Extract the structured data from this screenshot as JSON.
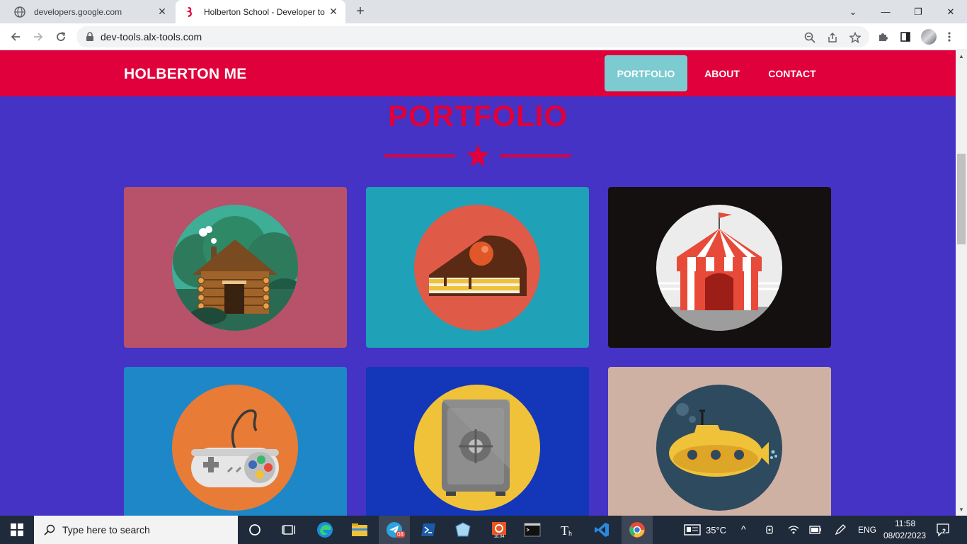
{
  "browser": {
    "tabs": [
      {
        "title": "developers.google.com",
        "active": false
      },
      {
        "title": "Holberton School - Developer to",
        "active": true
      }
    ],
    "url": "dev-tools.alx-tools.com"
  },
  "site": {
    "brand": "HOLBERTON ME",
    "nav": [
      {
        "label": "PORTFOLIO",
        "active": true
      },
      {
        "label": "ABOUT",
        "active": false
      },
      {
        "label": "CONTACT",
        "active": false
      }
    ],
    "section_title": "PORTFOLIO",
    "portfolio": [
      {
        "icon": "log-cabin-icon",
        "bg": "#b8516a"
      },
      {
        "icon": "cake-slice-icon",
        "bg": "#1fa1b8"
      },
      {
        "icon": "circus-tent-icon",
        "bg": "#141010"
      },
      {
        "icon": "game-controller-icon",
        "bg": "#1e87c8"
      },
      {
        "icon": "safe-icon",
        "bg": "#1337b8"
      },
      {
        "icon": "submarine-icon",
        "bg": "#ceb1a3"
      }
    ],
    "colors": {
      "accent": "#e0003b",
      "page_bg": "#4433c4",
      "active_nav": "#7bcbd0"
    }
  },
  "taskbar": {
    "search_placeholder": "Type here to search",
    "temperature": "35°C",
    "language": "ENG",
    "time": "11:58",
    "date": "08/02/2023",
    "notification_count": "2",
    "telegram_badge": "08"
  }
}
